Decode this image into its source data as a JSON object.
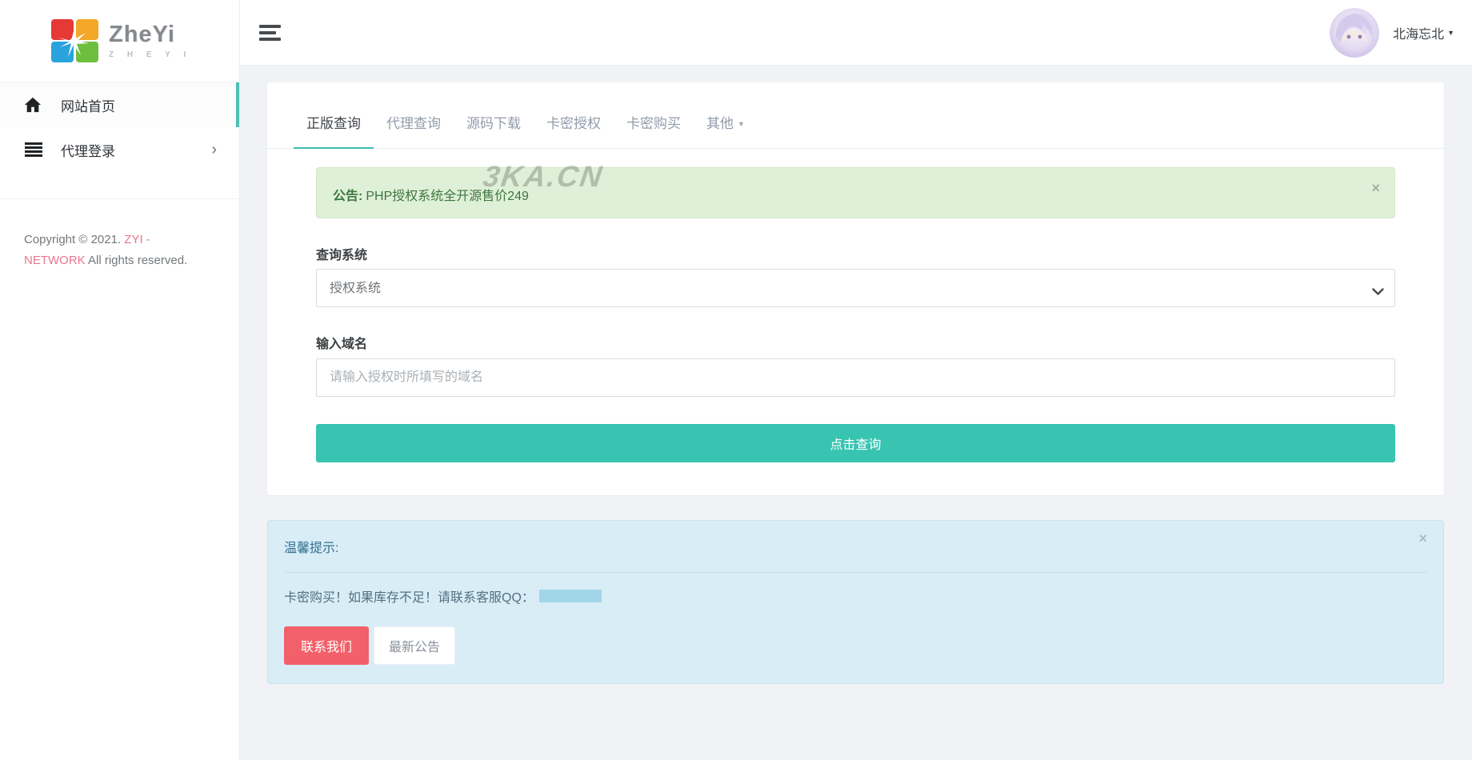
{
  "brand": {
    "title": "ZheYi",
    "subtitle": "Z H E Y I"
  },
  "sidebar": {
    "items": [
      {
        "label": "网站首页"
      },
      {
        "label": "代理登录"
      }
    ],
    "chevron": "›",
    "copyright_prefix": "Copyright © 2021. ",
    "copyright_brand": "ZYI - NETWORK",
    "copyright_suffix": " All rights reserved."
  },
  "navbar": {
    "username": "北海忘北",
    "caret": "▼"
  },
  "tabs": [
    {
      "label": "正版查询"
    },
    {
      "label": "代理查询"
    },
    {
      "label": "源码下载"
    },
    {
      "label": "卡密授权"
    },
    {
      "label": "卡密购买"
    },
    {
      "label": "其他"
    }
  ],
  "tab_caret": "▼",
  "alert": {
    "prefix": "公告:",
    "text": "PHP授权系统全开源售价249",
    "watermark": "3KA.CN",
    "close": "×"
  },
  "form": {
    "system_label": "查询系统",
    "system_value": "授权系统",
    "domain_label": "输入域名",
    "domain_placeholder": "请输入授权时所填写的域名",
    "submit_label": "点击查询"
  },
  "panel": {
    "title": "温馨提示:",
    "body": "卡密购买！如果库存不足！请联系客服QQ：",
    "contact_label": "联系我们",
    "news_label": "最新公告",
    "close": "×"
  },
  "colors": {
    "accent_teal": "#38c4b1",
    "active_border_teal": "#4dc0b5",
    "alert_green_bg": "#dff0d8",
    "alert_green_text": "#3c763d",
    "panel_blue_bg": "#d9edf7",
    "panel_blue_text": "#31708f",
    "danger_red": "#f2606a",
    "brand_pink": "#ea7491",
    "page_bg": "#f0f2f6"
  }
}
